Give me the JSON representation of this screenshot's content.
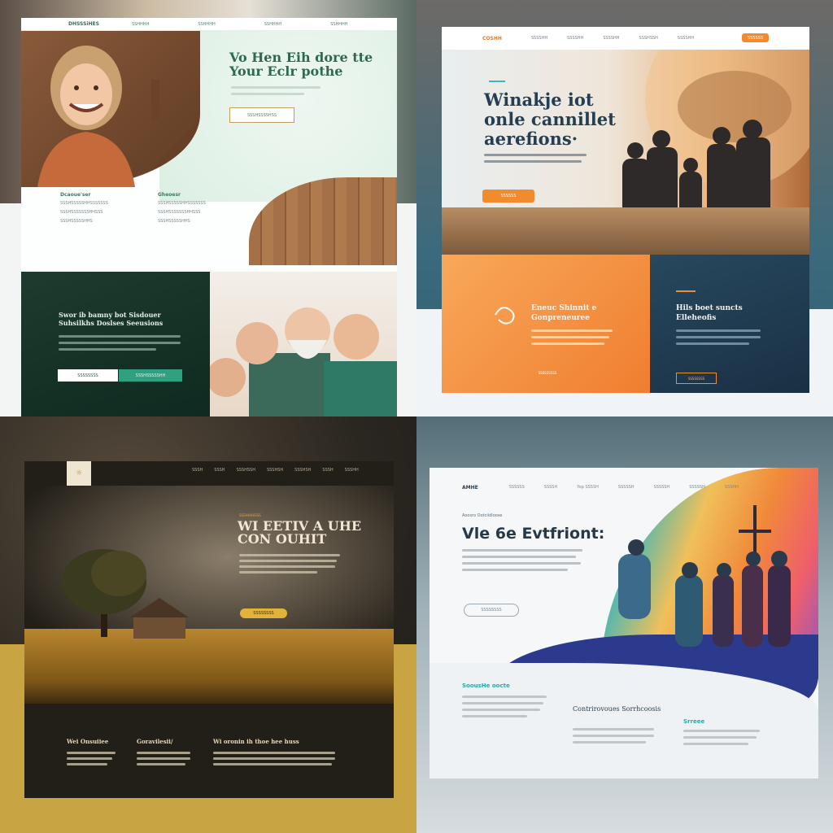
{
  "panel1": {
    "nav": [
      "DHSSSiHES",
      "SSHHHH",
      "SSHHHH",
      "SSHHHH",
      "SSHHHH"
    ],
    "headline": "Vo Hen Eih dore tte\nYour Eclr pothe",
    "cta": "SSSHSSSSHSS",
    "features": [
      {
        "title": "Dcaoue'ser",
        "lines": [
          "SSSHSSSSSHHSSSSSSS",
          "SSSHSSSSSSSHHSSS",
          "SSSHSSSSSHHS"
        ]
      },
      {
        "title": "Gheoesr",
        "lines": [
          "SSSHSSSSSHHSSSSSSS",
          "SSSHSSSSSSSHHSSS",
          "SSSHSSSSSHHS"
        ]
      }
    ],
    "green_headline": "Swor ib bamny bot Sisdouer\nSuhsilkhs Doslses Seeusions",
    "green_btn_1": "SSSSSSSS",
    "green_btn_2": "SSSHSSSSSHH"
  },
  "panel2": {
    "logo": "COSHH",
    "nav": [
      "SSSSHH",
      "SSSSHH",
      "SSSSHH",
      "SSSHSSH",
      "SSSSHH"
    ],
    "nav_button": "SSSSSS",
    "headline": "Winakje iot\nonle cannillet\naerefions·",
    "hero_button": "SSSSSS",
    "orange_title": "Eneuc Shinnit e\nGonpreneuree",
    "orange_link": "SSSSSSSSS",
    "navy_title": "Hils boet suncts\nElleheofis",
    "navy_button": "SSSSSSSS",
    "accent": "#f28a2e"
  },
  "panel3": {
    "logo_mark": "☼",
    "nav": [
      "SSSH",
      "SSSH",
      "SSSHSSH",
      "SSSHSH",
      "SSSHSH",
      "SSSH",
      "SSSHH"
    ],
    "kicker": "SSSHHHSSSS",
    "headline": "WI EETIV A UHE\nCON OUHIT",
    "cta": "SSSSSSSS",
    "col_titles": [
      "Wei Onsuiiee",
      "Goravilesii/",
      "Wi oronin ih thoe hee huss"
    ]
  },
  "panel4": {
    "logo": "AMHE",
    "nav": [
      "SSSSSS",
      "SSSSH",
      "Yop SSSSH",
      "SSSSSH",
      "SSSSSH",
      "SSSSSH",
      "SSSHH"
    ],
    "kicker": "Aoosro Ootciidloose",
    "headline": "Vle 6e Evtfriont:",
    "cta": "SSSSSSSS",
    "col1_title": "SoousHe oocte",
    "col2_title": "Contrirovoues\nSorrhcoosis",
    "col3_title": "Srreee",
    "brand_teal": "#2aa9a9"
  }
}
